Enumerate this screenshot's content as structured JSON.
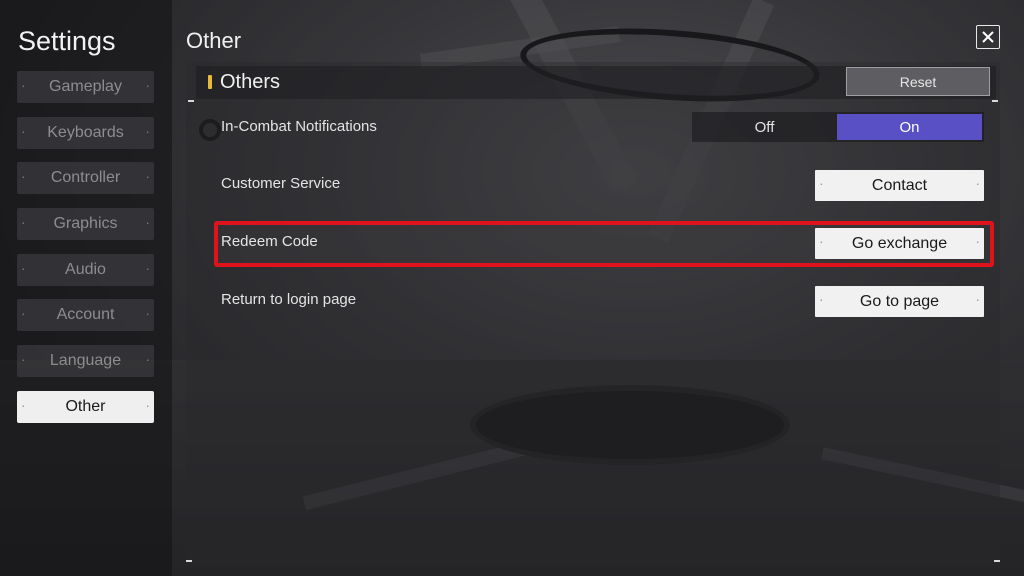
{
  "sidebar": {
    "title": "Settings",
    "items": [
      {
        "label": "Gameplay"
      },
      {
        "label": "Keyboards"
      },
      {
        "label": "Controller"
      },
      {
        "label": "Graphics"
      },
      {
        "label": "Audio"
      },
      {
        "label": "Account"
      },
      {
        "label": "Language"
      },
      {
        "label": "Other"
      }
    ],
    "active_item": "Other"
  },
  "main": {
    "page_title": "Other",
    "close_icon": "close-icon",
    "section": {
      "title": "Others",
      "reset_label": "Reset"
    },
    "rows": {
      "notifications": {
        "label": "In-Combat Notifications",
        "off_label": "Off",
        "on_label": "On",
        "selected": "On"
      },
      "customer_service": {
        "label": "Customer Service",
        "button_label": "Contact"
      },
      "redeem_code": {
        "label": "Redeem Code",
        "button_label": "Go exchange"
      },
      "return_login": {
        "label": "Return to login page",
        "button_label": "Go to page"
      }
    }
  },
  "colors": {
    "toggle_on": "#5a50c6",
    "highlight_border": "#e0121b",
    "section_marker": "#e9b93b"
  }
}
